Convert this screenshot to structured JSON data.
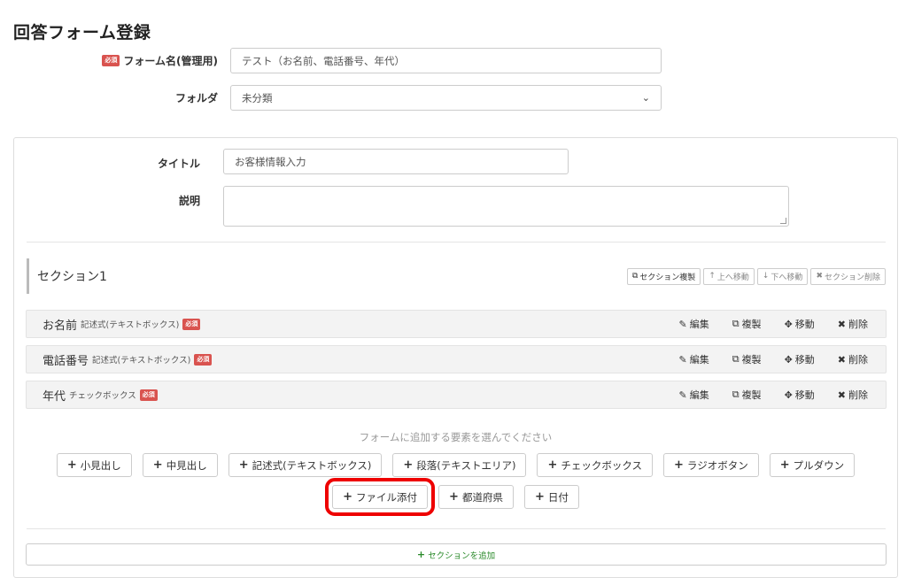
{
  "page": {
    "title": "回答フォーム登録"
  },
  "required_badge": "必須",
  "form_name": {
    "label": "フォーム名(管理用)",
    "value": "テスト（お名前、電話番号、年代）"
  },
  "folder": {
    "label": "フォルダ",
    "value": "未分類"
  },
  "section_settings": {
    "title_label": "タイトル",
    "title_value": "お客様情報入力",
    "desc_label": "説明",
    "desc_value": ""
  },
  "section": {
    "name": "セクション1",
    "actions": [
      {
        "icon": "copy-icon",
        "glyph": "⧉",
        "label": "セクション複製"
      },
      {
        "icon": "arrow-up-icon",
        "glyph": "↑",
        "label": "上へ移動"
      },
      {
        "icon": "arrow-down-icon",
        "glyph": "↓",
        "label": "下へ移動"
      },
      {
        "icon": "close-icon",
        "glyph": "✖",
        "label": "セクション削除"
      }
    ]
  },
  "questions": [
    {
      "name": "お名前",
      "type": "記述式(テキストボックス)"
    },
    {
      "name": "電話番号",
      "type": "記述式(テキストボックス)"
    },
    {
      "name": "年代",
      "type": "チェックボックス"
    }
  ],
  "question_actions": {
    "edit": "編集",
    "copy": "複製",
    "move": "移動",
    "delete": "削除"
  },
  "add_prompt": "フォームに追加する要素を選んでください",
  "add_buttons_row1": [
    "小見出し",
    "中見出し",
    "記述式(テキストボックス)",
    "段落(テキストエリア)",
    "チェックボックス",
    "ラジオボタン",
    "プルダウン"
  ],
  "add_buttons_row2": [
    "ファイル添付",
    "都道府県",
    "日付"
  ],
  "add_section_label": "セクションを追加",
  "colors": {
    "required": "#d9534f",
    "highlight": "#ee0000",
    "add_section_text": "#2a8a2a"
  }
}
